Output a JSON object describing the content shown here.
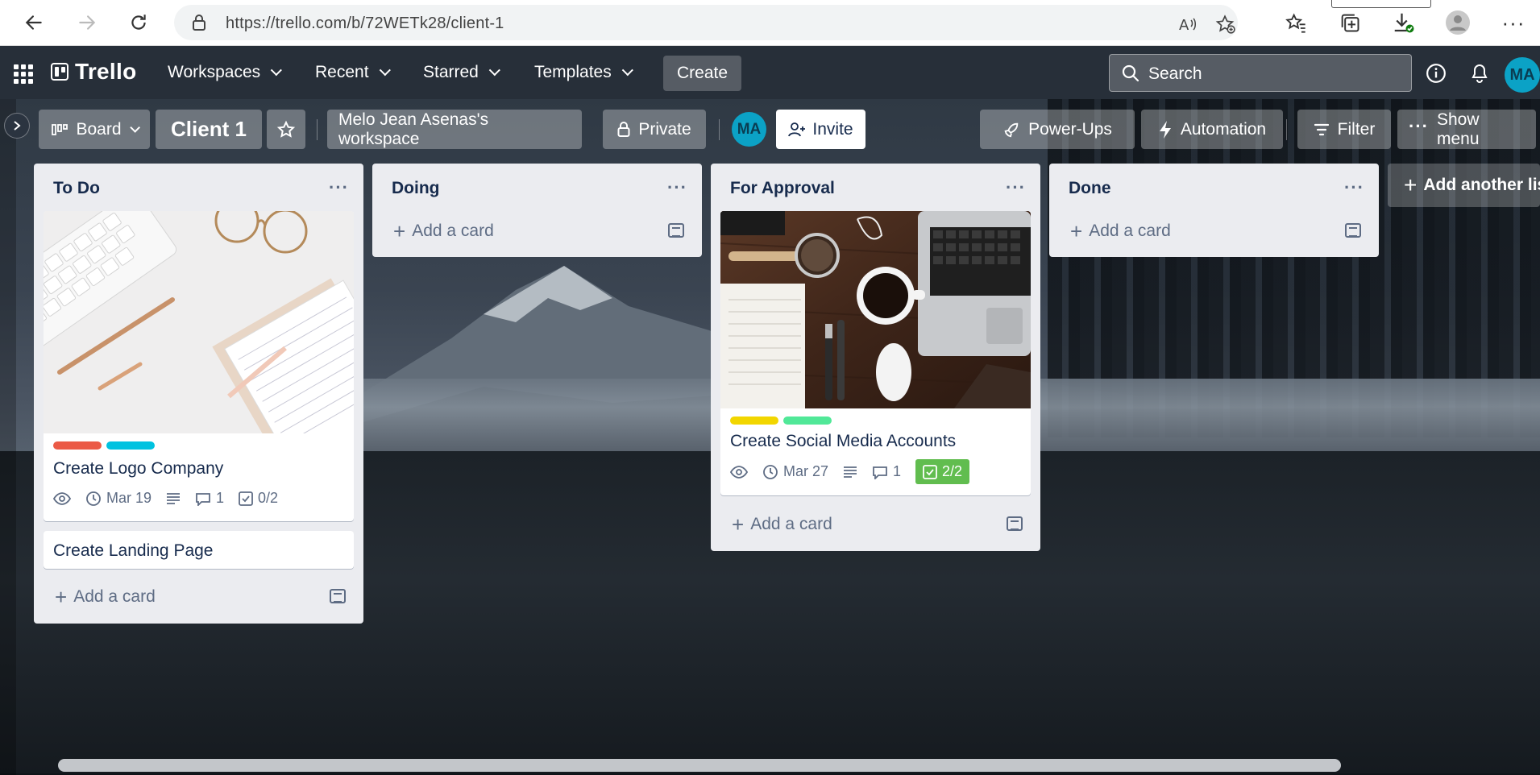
{
  "browser": {
    "url": "https://trello.com/b/72WETk28/client-1"
  },
  "header": {
    "logo": "Trello",
    "nav": [
      {
        "label": "Workspaces"
      },
      {
        "label": "Recent"
      },
      {
        "label": "Starred"
      },
      {
        "label": "Templates"
      }
    ],
    "create_label": "Create",
    "search_placeholder": "Search",
    "avatar_initials": "MA"
  },
  "board": {
    "view_label": "Board",
    "title": "Client 1",
    "workspace": "Melo Jean Asenas's workspace",
    "visibility": "Private",
    "member_initials": "MA",
    "invite_label": "Invite",
    "powerups_label": "Power-Ups",
    "automation_label": "Automation",
    "filter_label": "Filter",
    "show_menu_label": "Show menu",
    "add_list_label": "Add another lis"
  },
  "lists": [
    {
      "title": "To Do",
      "add_card_label": "Add a card",
      "cards": [
        {
          "title": "Create Logo Company",
          "labels": [
            "#eb5a46",
            "#00c2e0"
          ],
          "due": "Mar 19",
          "comments": "1",
          "checklist": "0/2"
        },
        {
          "title": "Create Landing Page"
        }
      ]
    },
    {
      "title": "Doing",
      "add_card_label": "Add a card",
      "cards": []
    },
    {
      "title": "For Approval",
      "add_card_label": "Add a card",
      "cards": [
        {
          "title": "Create Social Media Accounts",
          "labels": [
            "#f2d600",
            "#51e898"
          ],
          "due": "Mar 27",
          "comments": "1",
          "checklist": "2/2"
        }
      ]
    },
    {
      "title": "Done",
      "add_card_label": "Add a card",
      "cards": []
    }
  ],
  "colors": {
    "label_red": "#eb5a46",
    "label_sky": "#00c2e0",
    "label_yellow": "#f2d600",
    "label_lime": "#51e898",
    "checklist_done": "#61bd4f",
    "avatar": "#0ba2c6"
  }
}
